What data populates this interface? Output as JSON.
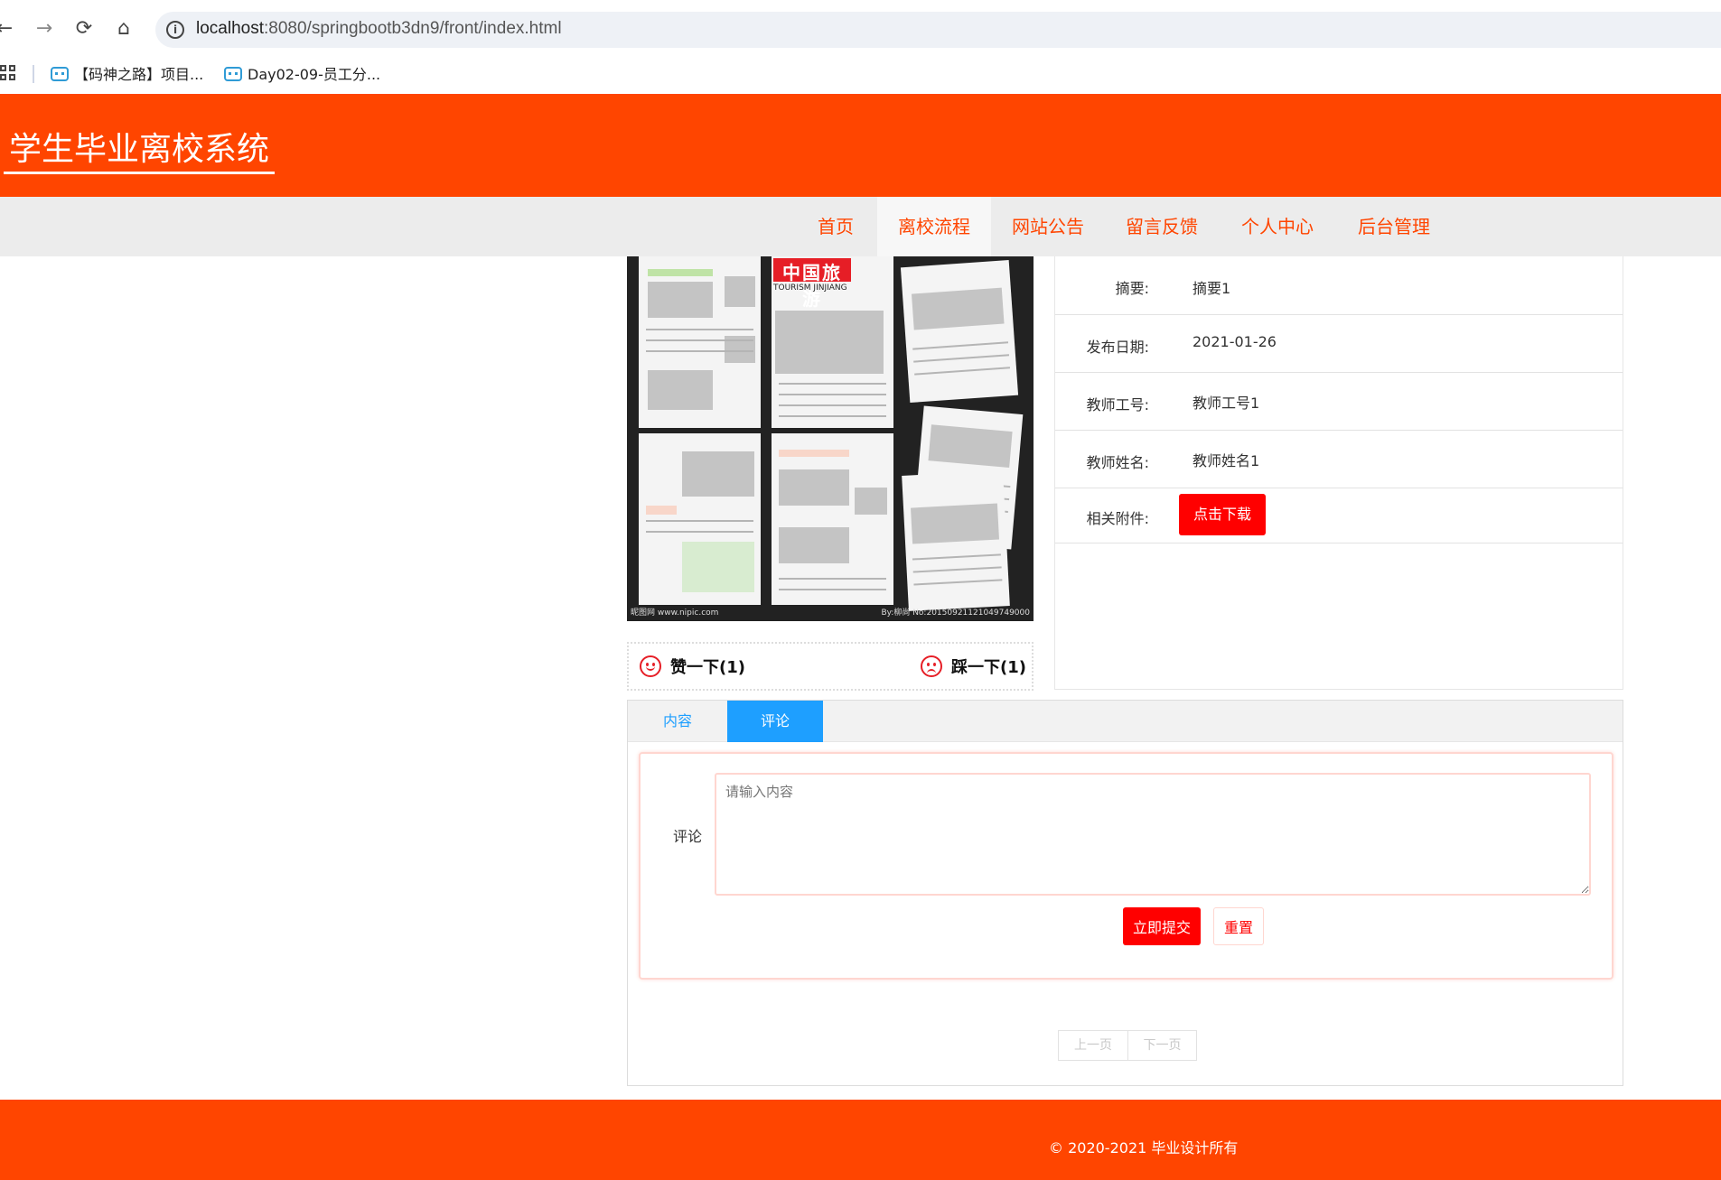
{
  "browser": {
    "url_host": "localhost",
    "url_rest": ":8080/springbootb3dn9/front/index.html",
    "bookmarks": [
      "【码神之路】项目...",
      "Day02-09-员工分..."
    ]
  },
  "site": {
    "title": "学生毕业离校系统",
    "nav": [
      "首页",
      "离校流程",
      "网站公告",
      "留言反馈",
      "个人中心",
      "后台管理"
    ],
    "active_nav": "离校流程"
  },
  "image": {
    "logo_text": "中国旅游",
    "logo_sub": "TOURISM JINJIANG",
    "watermark_left": "昵图网 www.nipic.com",
    "watermark_right": "By:柳尚 No:20150921121049749000"
  },
  "votes": {
    "like_label": "赞一下(1)",
    "dislike_label": "踩一下(1)"
  },
  "details": {
    "summary_label": "摘要:",
    "summary_value": "摘要1",
    "date_label": "发布日期:",
    "date_value": "2021-01-26",
    "teacher_id_label": "教师工号:",
    "teacher_id_value": "教师工号1",
    "teacher_name_label": "教师姓名:",
    "teacher_name_value": "教师姓名1",
    "attachment_label": "相关附件:",
    "download_label": "点击下载"
  },
  "tabs": {
    "content": "内容",
    "comment": "评论",
    "active": "评论"
  },
  "comment_form": {
    "label": "评论",
    "placeholder": "请输入内容",
    "submit_label": "立即提交",
    "reset_label": "重置"
  },
  "pager": {
    "prev": "上一页",
    "next": "下一页"
  },
  "footer": {
    "text": "© 2020-2021 毕业设计所有"
  },
  "colors": {
    "brand": "#ff4500",
    "accent_blue": "#1e9fff",
    "button_red": "#ff0000"
  }
}
